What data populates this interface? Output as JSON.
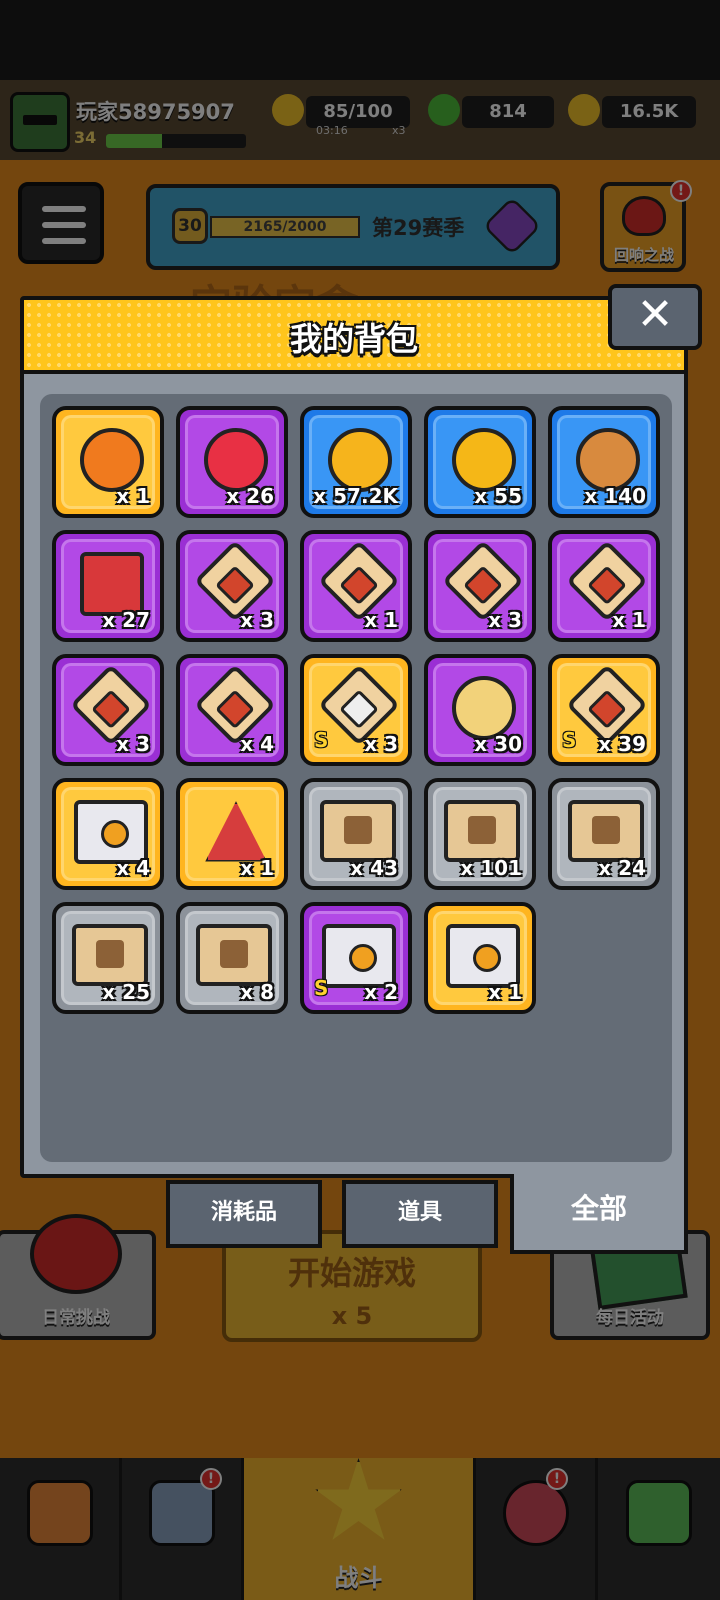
{
  "topbar": {
    "player_name": "玩家58975907",
    "level": "34",
    "xp_fraction": 0.4,
    "energy": "85/100",
    "energy_timer": "03:16",
    "energy_multiplier": "x3",
    "gems": "814",
    "coins": "16.5K"
  },
  "season": {
    "level": "30",
    "progress": "2165/2000",
    "label": "第29赛季"
  },
  "echo_battle": {
    "label": "回响之战",
    "badge": "!"
  },
  "lobby": {
    "title_partial": "宝验宝盒",
    "daily_challenge": "日常挑战",
    "start_game": "开始游戏",
    "start_cost": "x 5",
    "daily_event": "每日活动"
  },
  "bottom_nav": {
    "battle_label": "战斗",
    "shop_badge": "!",
    "team_badge": "!"
  },
  "modal": {
    "title": "我的背包",
    "close": "✕",
    "items": [
      {
        "rarity": "orange",
        "icon": "dna-orb-icon",
        "qty": "x 1",
        "s": false
      },
      {
        "rarity": "purple",
        "icon": "heart-orb-icon",
        "qty": "x 26",
        "s": false
      },
      {
        "rarity": "blue",
        "icon": "gold-drop-icon",
        "qty": "x 57.2K",
        "s": false
      },
      {
        "rarity": "blue",
        "icon": "gold-coin-icon",
        "qty": "x 55",
        "s": false
      },
      {
        "rarity": "blue",
        "icon": "dog-cookie-icon",
        "qty": "x 140",
        "s": false
      },
      {
        "rarity": "purple",
        "icon": "red-book-icon",
        "qty": "x 27",
        "s": false
      },
      {
        "rarity": "purple",
        "icon": "puzzle-hero-icon",
        "qty": "x 3",
        "s": false
      },
      {
        "rarity": "purple",
        "icon": "puzzle-hero-icon",
        "qty": "x 1",
        "s": false
      },
      {
        "rarity": "purple",
        "icon": "puzzle-hero-icon",
        "qty": "x 3",
        "s": false
      },
      {
        "rarity": "purple",
        "icon": "puzzle-hero-icon",
        "qty": "x 1",
        "s": false
      },
      {
        "rarity": "purple",
        "icon": "puzzle-hero-icon",
        "qty": "x 3",
        "s": false
      },
      {
        "rarity": "purple",
        "icon": "puzzle-hero-icon",
        "qty": "x 4",
        "s": false
      },
      {
        "rarity": "orange",
        "icon": "puzzle-skull-icon",
        "qty": "x 3",
        "s": true
      },
      {
        "rarity": "purple",
        "icon": "cheese-slice-icon",
        "qty": "x 30",
        "s": false
      },
      {
        "rarity": "orange",
        "icon": "puzzle-hero-icon",
        "qty": "x 39",
        "s": true
      },
      {
        "rarity": "orange",
        "icon": "chest-icon",
        "qty": "x 4",
        "s": false
      },
      {
        "rarity": "orange",
        "icon": "triangle-crystal-icon",
        "qty": "x 1",
        "s": false
      },
      {
        "rarity": "gray",
        "icon": "scroll-gun-icon",
        "qty": "x 43",
        "s": false
      },
      {
        "rarity": "gray",
        "icon": "scroll-shirt-icon",
        "qty": "x 101",
        "s": false
      },
      {
        "rarity": "gray",
        "icon": "scroll-belt-icon",
        "qty": "x 24",
        "s": false
      },
      {
        "rarity": "gray",
        "icon": "scroll-glove-icon",
        "qty": "x 25",
        "s": false
      },
      {
        "rarity": "gray",
        "icon": "scroll-boot-icon",
        "qty": "x 8",
        "s": false
      },
      {
        "rarity": "purple",
        "icon": "chest-icon",
        "qty": "x 2",
        "s": true
      },
      {
        "rarity": "orange",
        "icon": "chest-icon",
        "qty": "x 1",
        "s": false
      }
    ],
    "tabs": {
      "consumables": "消耗品",
      "props": "道具",
      "all": "全部"
    }
  }
}
